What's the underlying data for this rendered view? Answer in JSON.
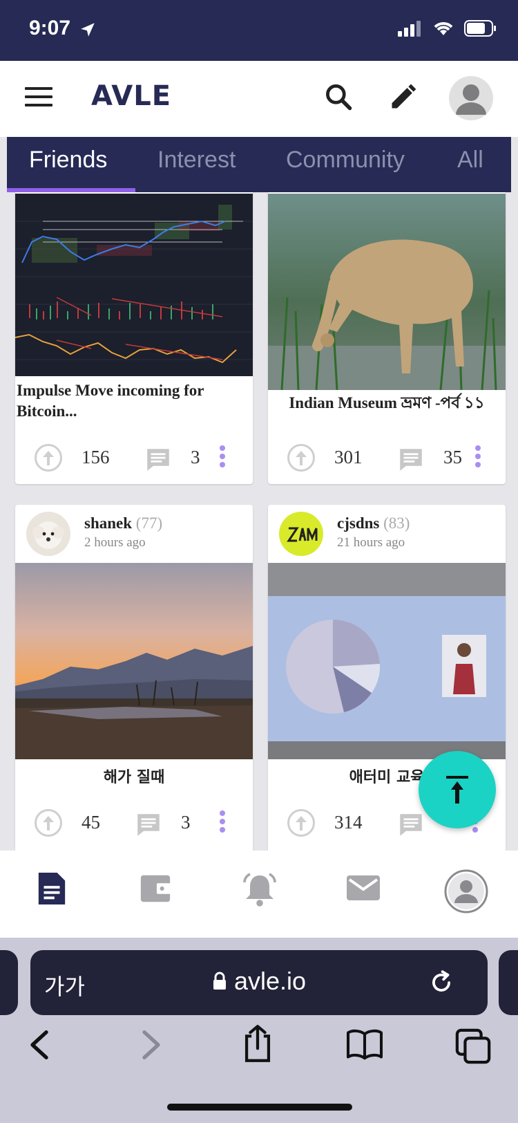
{
  "status": {
    "time": "9:07"
  },
  "header": {
    "logo": "AVLE"
  },
  "tabs": [
    {
      "label": "Friends",
      "active": true
    },
    {
      "label": "Interest",
      "active": false
    },
    {
      "label": "Community",
      "active": false
    },
    {
      "label": "All",
      "active": false
    }
  ],
  "posts": [
    {
      "title": "Impulse Move incoming for Bitcoin...",
      "votes": "156",
      "comments": "3"
    },
    {
      "title": "Indian Museum ভ্রমণ -পর্ব ১১",
      "votes": "301",
      "comments": "35"
    },
    {
      "author": "shanek",
      "reputation": "(77)",
      "time": "2 hours ago",
      "title": "해가 질때",
      "votes": "45",
      "comments": "3"
    },
    {
      "author": "cjsdns",
      "reputation": "(83)",
      "time": "21 hours ago",
      "title": "애터미 교육",
      "votes": "314",
      "comments": ""
    }
  ],
  "browser": {
    "text_size": "가가",
    "url": "avle.io"
  },
  "colors": {
    "brand": "#262a55",
    "accent": "#8f5fe8",
    "fab": "#1bd3c4"
  }
}
